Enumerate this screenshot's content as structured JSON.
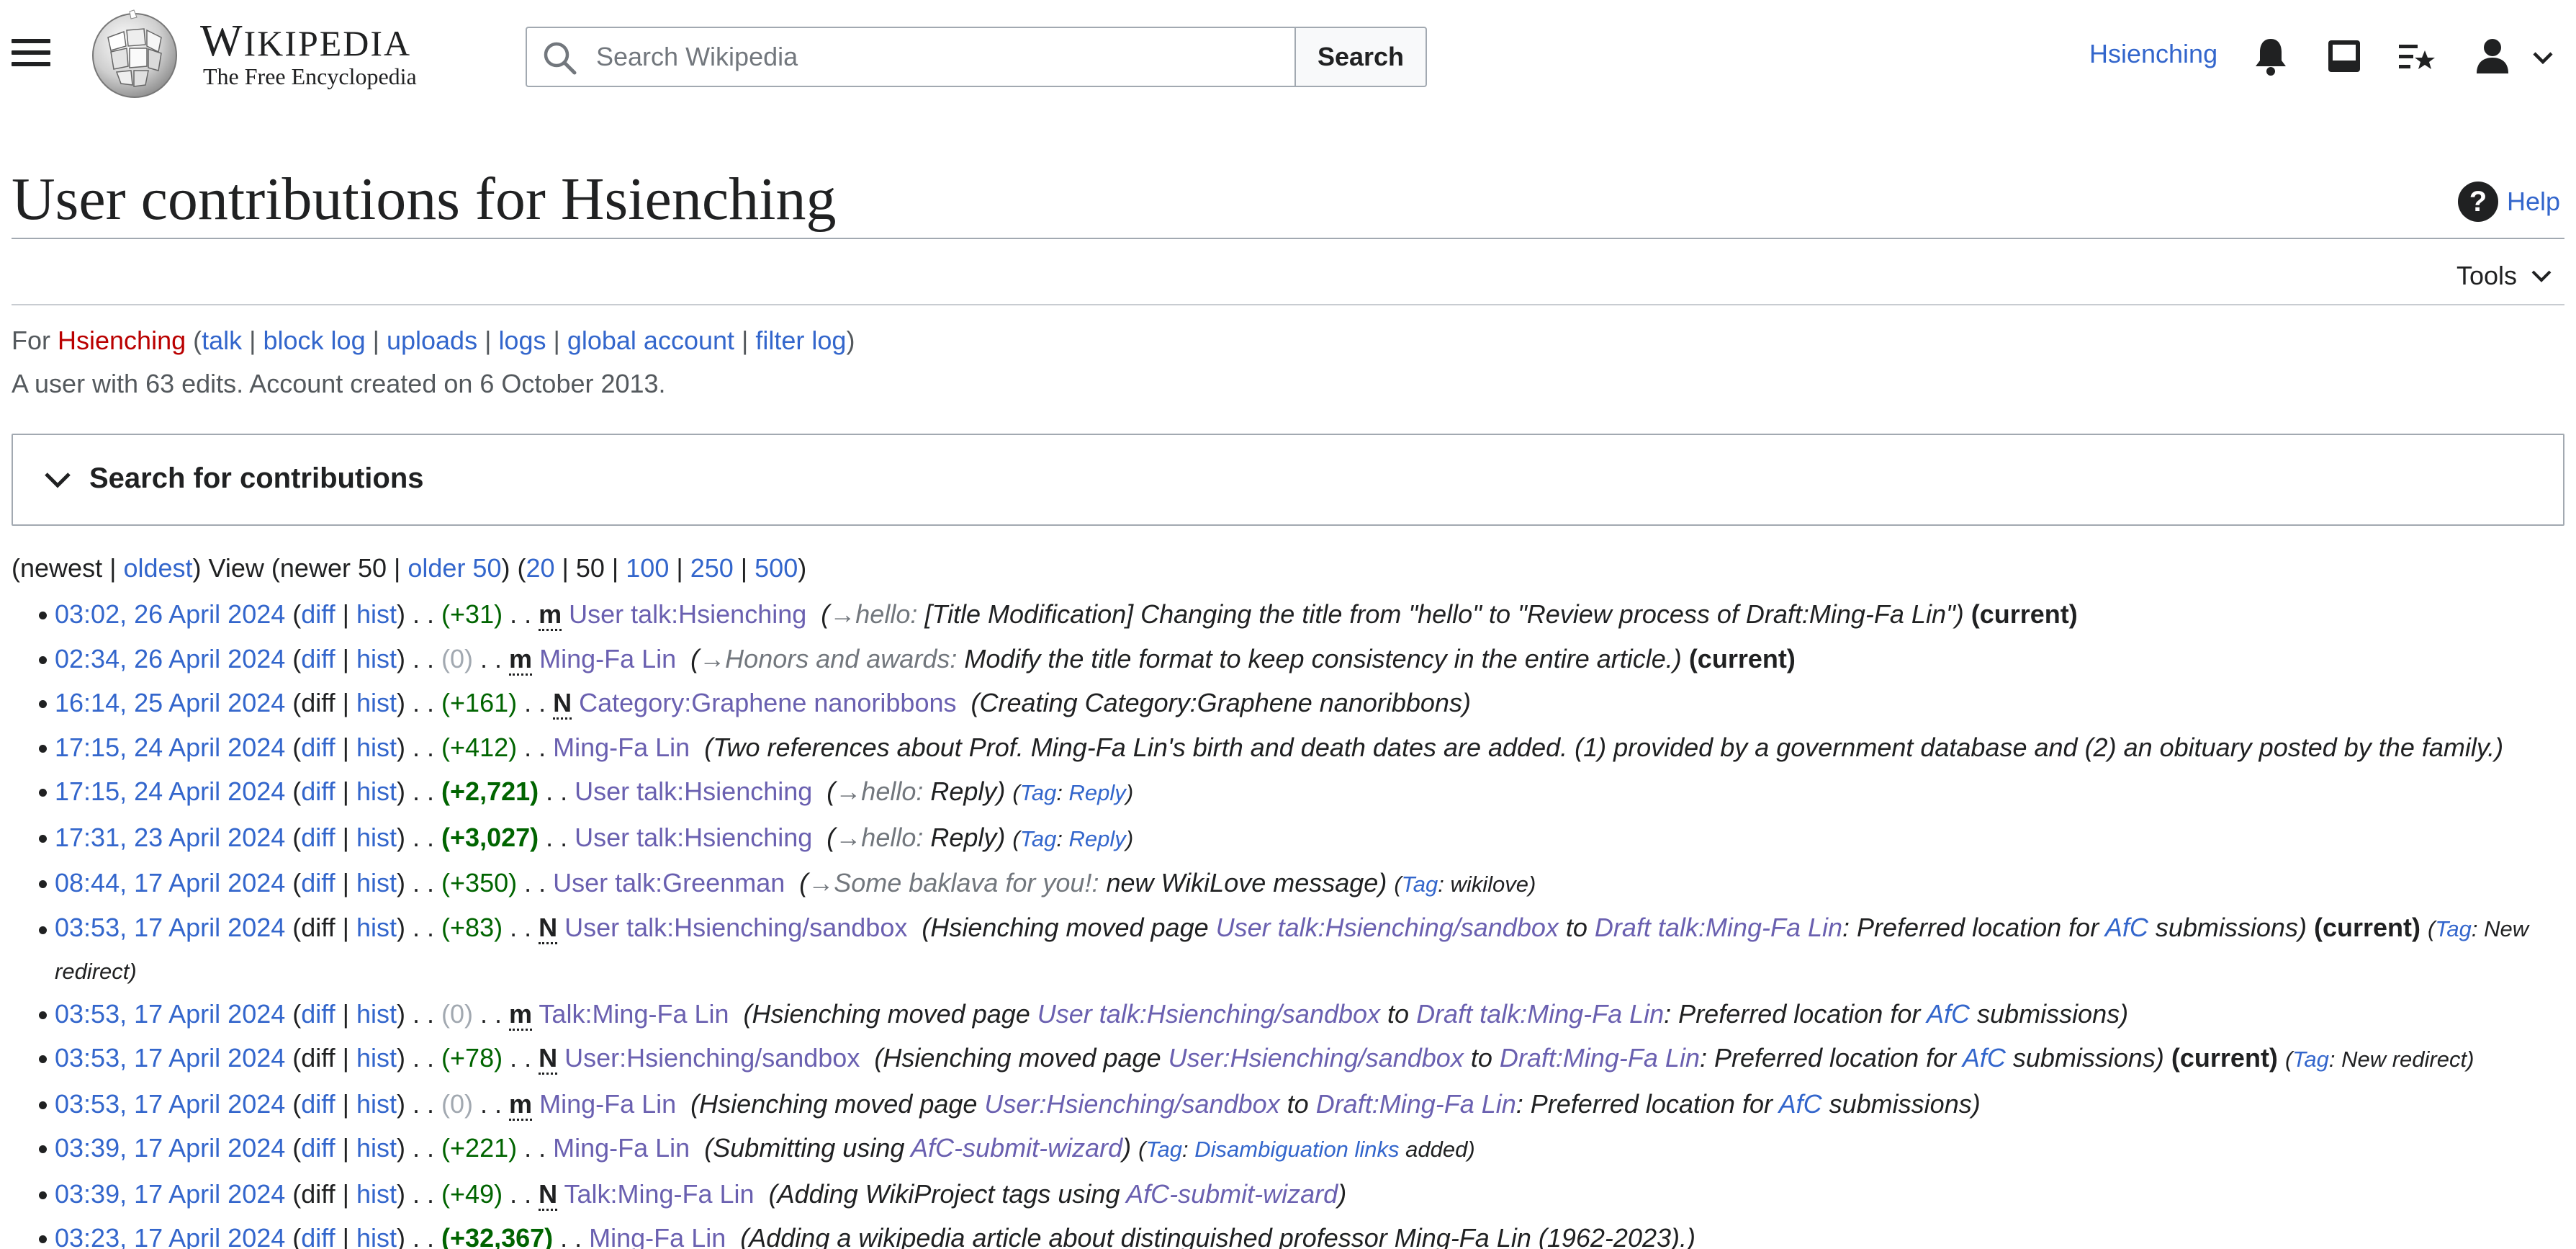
{
  "header": {
    "wordmark_first": "W",
    "wordmark_rest": "IKIPEDIA",
    "wordmark_last": "",
    "tagline": "The Free Encyclopedia",
    "search_placeholder": "Search Wikipedia",
    "search_button": "Search",
    "username": "Hsienching",
    "icons": [
      "menu-icon",
      "wikipedia-globe-logo",
      "search-icon",
      "notifications-bell-icon",
      "inbox-tray-icon",
      "watchlist-icon",
      "user-avatar-icon",
      "chevron-down-icon"
    ]
  },
  "title": {
    "text": "User contributions for Hsienching",
    "help": "Help",
    "help_icon": "?",
    "tools": "Tools"
  },
  "user_info": {
    "prefix": "For",
    "user": "Hsienching",
    "links": [
      "talk",
      "block log",
      "uploads",
      "logs",
      "global account",
      "filter log"
    ],
    "summary": "A user with 63 edits. Account created on 6 October 2013."
  },
  "search_panel": {
    "title": "Search for contributions"
  },
  "pager": {
    "newest": "newest",
    "oldest": "oldest",
    "view": "View",
    "newer": "newer 50",
    "older": "older 50",
    "limits": [
      "20",
      "50",
      "100",
      "250",
      "500"
    ],
    "current_limit": "50"
  },
  "contributions": [
    {
      "time": "03:02, 26 April 2024",
      "diff": "diff",
      "hist": "hist",
      "size": "(+31)",
      "flag": "m",
      "page": "User talk:Hsienching",
      "section": "→hello:",
      "comment": " [Title Modification] Changing the title from \"hello\" to \"Review process of Draft:Ming-Fa Lin\")",
      "current": "(current)"
    },
    {
      "time": "02:34, 26 April 2024",
      "diff": "diff",
      "hist": "hist",
      "size": "(0)",
      "flag": "m",
      "page": "Ming-Fa Lin",
      "section": "→Honors and awards:",
      "comment": " Modify the title format to keep consistency in the entire article.)",
      "current": "(current)"
    },
    {
      "time": "16:14, 25 April 2024",
      "diff": "diff",
      "hist": "hist",
      "size": "(+161)",
      "flag": "N",
      "page": "Category:Graphene nanoribbons",
      "comment": "Creating Category:Graphene nanoribbons)"
    },
    {
      "time": "17:15, 24 April 2024",
      "diff": "diff",
      "hist": "hist",
      "size": "(+412)",
      "page": "Ming-Fa Lin",
      "comment": "Two references about Prof. Ming-Fa Lin's birth and death dates are added. (1) provided by a government database and (2) an obituary posted by the family.)"
    },
    {
      "time": "17:15, 24 April 2024",
      "diff": "diff",
      "hist": "hist",
      "size": "(+2,721)",
      "page": "User talk:Hsienching",
      "section": "→hello:",
      "comment": " Reply)",
      "tag_label": "Tag",
      "tag": "Reply"
    },
    {
      "time": "17:31, 23 April 2024",
      "diff": "diff",
      "hist": "hist",
      "size": "(+3,027)",
      "page": "User talk:Hsienching",
      "section": "→hello:",
      "comment": " Reply)",
      "tag_label": "Tag",
      "tag": "Reply"
    },
    {
      "time": "08:44, 17 April 2024",
      "diff": "diff",
      "hist": "hist",
      "size": "(+350)",
      "page": "User talk:Greenman",
      "section": "→Some baklava for you!:",
      "comment": " new WikiLove message)",
      "tag_label": "Tag",
      "tag": "wikilove"
    },
    {
      "time": "03:53, 17 April 2024",
      "diff": "diff",
      "hist": "hist",
      "size": "(+83)",
      "flag": "N",
      "page": "User talk:Hsienching/sandbox",
      "move_from": "User talk:Hsienching/sandbox",
      "move_to": "Draft talk:Ming-Fa Lin",
      "current": "(current)",
      "tag_label": "Tag",
      "tag": "New redirect"
    },
    {
      "time": "03:53, 17 April 2024",
      "diff": "diff",
      "hist": "hist",
      "size": "(0)",
      "flag": "m",
      "page": "Talk:Ming-Fa Lin",
      "move_from": "User talk:Hsienching/sandbox",
      "move_to": "Draft talk:Ming-Fa Lin"
    },
    {
      "time": "03:53, 17 April 2024",
      "diff": "diff",
      "hist": "hist",
      "size": "(+78)",
      "flag": "N",
      "page": "User:Hsienching/sandbox",
      "move_from": "User:Hsienching/sandbox",
      "move_to": "Draft:Ming-Fa Lin",
      "current": "(current)",
      "tag_label": "Tag",
      "tag": "New redirect"
    },
    {
      "time": "03:53, 17 April 2024",
      "diff": "diff",
      "hist": "hist",
      "size": "(0)",
      "flag": "m",
      "page": "Ming-Fa Lin",
      "move_from": "User:Hsienching/sandbox",
      "move_to": "Draft:Ming-Fa Lin"
    },
    {
      "time": "03:39, 17 April 2024",
      "diff": "diff",
      "hist": "hist",
      "size": "(+221)",
      "page": "Ming-Fa Lin",
      "comment_pre": "Submitting using ",
      "comment_link": "AfC-submit-wizard",
      "comment_post": ")",
      "tag_label": "Tag",
      "tag": "Disambiguation links",
      "tag_suffix": " added"
    },
    {
      "time": "03:39, 17 April 2024",
      "diff": "diff",
      "hist": "hist",
      "size": "(+49)",
      "flag": "N",
      "page": "Talk:Ming-Fa Lin",
      "comment_pre": "Adding WikiProject tags using ",
      "comment_link": "AfC-submit-wizard",
      "comment_post": ")"
    },
    {
      "time": "03:23, 17 April 2024",
      "diff": "diff",
      "hist": "hist",
      "size": "(+32,367)",
      "page": "Ming-Fa Lin",
      "comment": "Adding a wikipedia article about distinguished professor Ming-Fa Lin (1962-2023).)"
    }
  ],
  "move_text": {
    "who": "Hsienching moved page ",
    "to": " to ",
    "reason_pre": ": Preferred location for ",
    "afc": "AfC",
    "reason_post": " submissions)"
  },
  "colors": {
    "link": "#3366cc",
    "visited": "#6a60b0",
    "red_link": "#ba0000",
    "positive": "#006400",
    "neutral": "#a2a9b1",
    "text": "#202122"
  }
}
